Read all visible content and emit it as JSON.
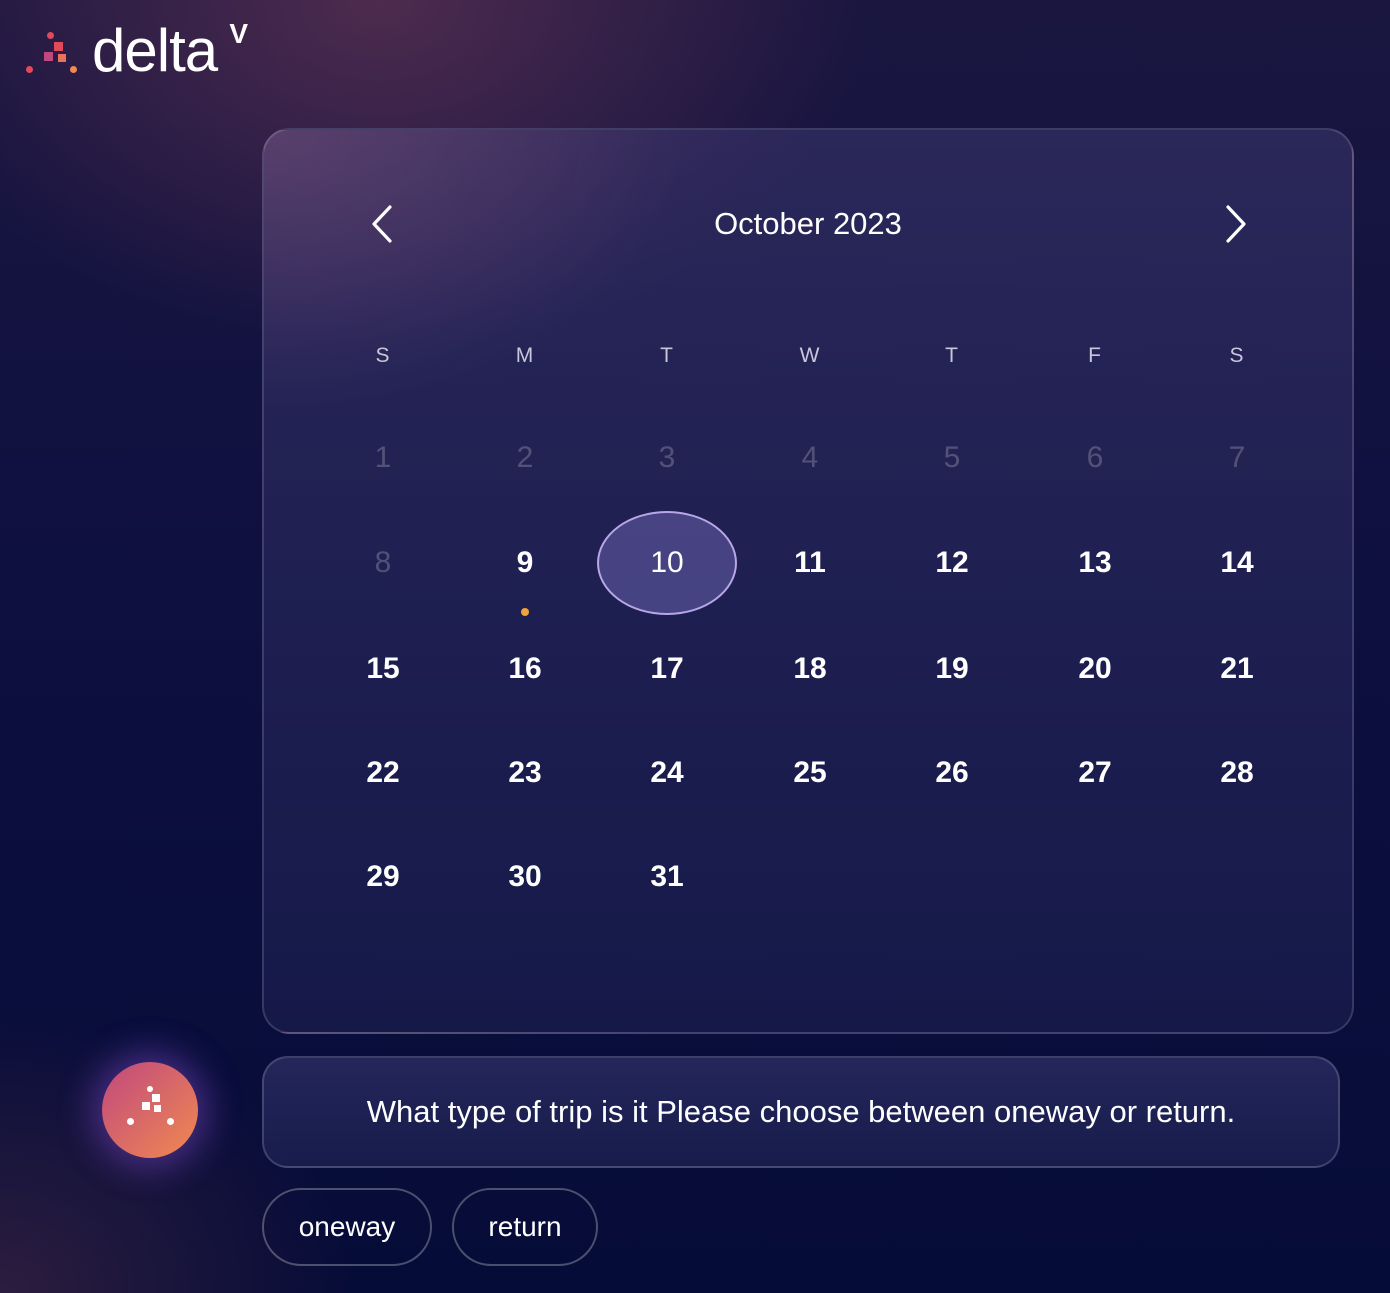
{
  "brand": {
    "name": "delta",
    "superscript": "V",
    "colors": {
      "mark_red": "#e04a5a",
      "mark_pink": "#c0487e",
      "mark_orange": "#f08a50"
    }
  },
  "calendar": {
    "month_title": "October 2023",
    "prev_icon": "chevron-left-icon",
    "next_icon": "chevron-right-icon",
    "weekdays": [
      "S",
      "M",
      "T",
      "W",
      "T",
      "F",
      "S"
    ],
    "weeks": [
      [
        {
          "label": "1",
          "state": "disabled"
        },
        {
          "label": "2",
          "state": "disabled"
        },
        {
          "label": "3",
          "state": "disabled"
        },
        {
          "label": "4",
          "state": "disabled"
        },
        {
          "label": "5",
          "state": "disabled"
        },
        {
          "label": "6",
          "state": "disabled"
        },
        {
          "label": "7",
          "state": "disabled"
        }
      ],
      [
        {
          "label": "8",
          "state": "disabled"
        },
        {
          "label": "9",
          "state": "today"
        },
        {
          "label": "10",
          "state": "selected"
        },
        {
          "label": "11",
          "state": "enabled"
        },
        {
          "label": "12",
          "state": "enabled"
        },
        {
          "label": "13",
          "state": "enabled"
        },
        {
          "label": "14",
          "state": "enabled"
        }
      ],
      [
        {
          "label": "15",
          "state": "enabled"
        },
        {
          "label": "16",
          "state": "enabled"
        },
        {
          "label": "17",
          "state": "enabled"
        },
        {
          "label": "18",
          "state": "enabled"
        },
        {
          "label": "19",
          "state": "enabled"
        },
        {
          "label": "20",
          "state": "enabled"
        },
        {
          "label": "21",
          "state": "enabled"
        }
      ],
      [
        {
          "label": "22",
          "state": "enabled"
        },
        {
          "label": "23",
          "state": "enabled"
        },
        {
          "label": "24",
          "state": "enabled"
        },
        {
          "label": "25",
          "state": "enabled"
        },
        {
          "label": "26",
          "state": "enabled"
        },
        {
          "label": "27",
          "state": "enabled"
        },
        {
          "label": "28",
          "state": "enabled"
        }
      ],
      [
        {
          "label": "29",
          "state": "enabled"
        },
        {
          "label": "30",
          "state": "enabled"
        },
        {
          "label": "31",
          "state": "enabled"
        }
      ]
    ],
    "colors": {
      "today_dot": "#f0a43a",
      "selected_border": "#b8a6e6"
    }
  },
  "chat": {
    "bot_avatar_icon": "deltav-logo-icon",
    "message": "What type of trip is it Please choose between oneway or return.",
    "choices": [
      "oneway",
      "return"
    ]
  }
}
